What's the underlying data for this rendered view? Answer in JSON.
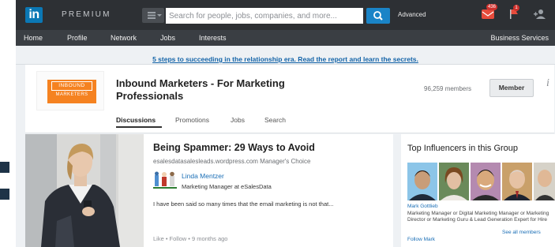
{
  "topbar": {
    "logo_text": "in",
    "premium_label": "PREMIUM",
    "search_placeholder": "Search for people, jobs, companies, and more...",
    "advanced_label": "Advanced",
    "mail_count": "436",
    "notification_count": "1"
  },
  "nav": {
    "items": [
      "Home",
      "Profile",
      "Network",
      "Jobs",
      "Interests"
    ],
    "business_services": "Business Services"
  },
  "announcement": "5 steps to succeeding in the relationship era. Read the report and learn the secrets.",
  "group": {
    "logo_line1": "INBOUND",
    "logo_line2": "MARKETERS",
    "title": "Inbound Marketers - For Marketing Professionals",
    "members": "96,259 members",
    "member_button": "Member",
    "info_icon": "i",
    "tabs": [
      "Discussions",
      "Promotions",
      "Jobs",
      "Search"
    ],
    "active_tab": "Discussions"
  },
  "post": {
    "title": "Being Spammer: 29 Ways to Avoid",
    "source": "esalesdatasalesleads.wordpress.com  Manager's Choice",
    "author_name": "Linda Mentzer",
    "author_role": "Marketing Manager at eSalesData",
    "snippet": "I have been said so many times that the email marketing is not that...",
    "meta": "Like  •  Follow  •  9 months ago"
  },
  "influencers": {
    "title": "Top Influencers in this Group",
    "name": "Mark Gottlieb",
    "description": "Marketing Manager or Digital Marketing Manager or Marketing Director or Marketing Guru & Lead Generation Expert for Hire",
    "see_all": "See all members",
    "follow": "Follow Mark"
  },
  "colors": {
    "topbar": "#2d3034",
    "nav": "#3a3e43",
    "linkedin_blue": "#0b78b5",
    "link": "#1a6eb6",
    "orange_brand": "#f58220"
  }
}
